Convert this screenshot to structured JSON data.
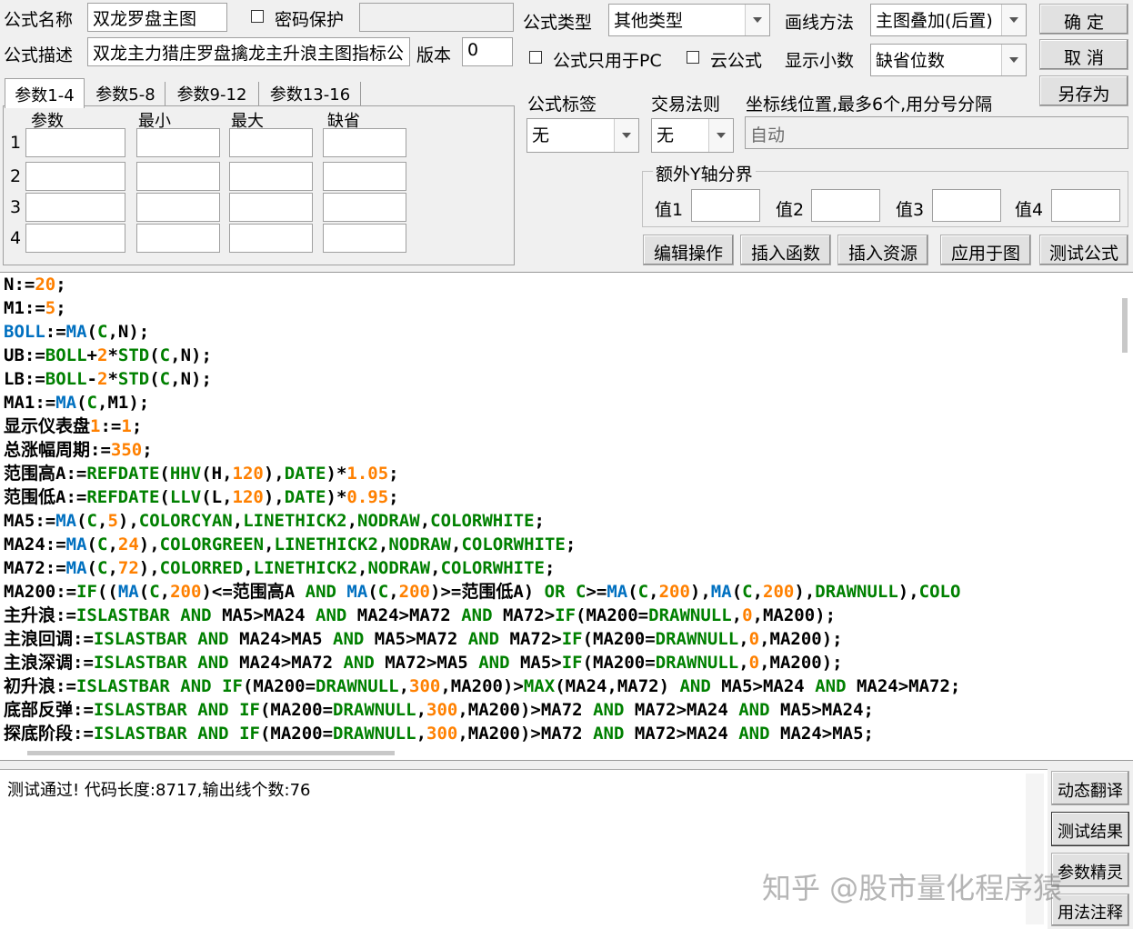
{
  "header": {
    "name_label": "公式名称",
    "name_value": "双龙罗盘主图",
    "password_label": "密码保护",
    "desc_label": "公式描述",
    "desc_value": "双龙主力猎庄罗盘擒龙主升浪主图指标公",
    "version_label": "版本",
    "version_value": "0",
    "type_label": "公式类型",
    "type_value": "其他类型",
    "draw_label": "画线方法",
    "draw_value": "主图叠加(后置)",
    "pc_only_label": "公式只用于PC",
    "cloud_label": "云公式",
    "decimal_label": "显示小数",
    "decimal_value": "缺省位数",
    "tag_label": "公式标签",
    "tag_value": "无",
    "trade_label": "交易法则",
    "trade_value": "无",
    "axis_label": "坐标线位置,最多6个,用分号分隔",
    "axis_value": "自动",
    "extra_y_label": "额外Y轴分界",
    "y1_label": "值1",
    "y2_label": "值2",
    "y3_label": "值3",
    "y4_label": "值4"
  },
  "buttons": {
    "ok": "确 定",
    "cancel": "取 消",
    "save_as": "另存为",
    "edit": "编辑操作",
    "insert_func": "插入函数",
    "insert_res": "插入资源",
    "apply": "应用于图",
    "test": "测试公式"
  },
  "params": {
    "tabs": [
      "参数1-4",
      "参数5-8",
      "参数9-12",
      "参数13-16"
    ],
    "columns": [
      "参数",
      "最小",
      "最大",
      "缺省"
    ],
    "rows": [
      "1",
      "2",
      "3",
      "4"
    ]
  },
  "code_lines": [
    "N:=20;",
    "M1:=5;",
    "BOLL:=MA(C,N);",
    "UB:=BOLL+2*STD(C,N);",
    "LB:=BOLL-2*STD(C,N);",
    "MA1:=MA(C,M1);",
    "显示仪表盘1:=1;",
    "总涨幅周期:=350;",
    "范围高A:=REFDATE(HHV(H,120),DATE)*1.05;",
    "范围低A:=REFDATE(LLV(L,120),DATE)*0.95;",
    "MA5:=MA(C,5),COLORCYAN,LINETHICK2,NODRAW,COLORWHITE;",
    "MA24:=MA(C,24),COLORGREEN,LINETHICK2,NODRAW,COLORWHITE;",
    "MA72:=MA(C,72),COLORRED,LINETHICK2,NODRAW,COLORWHITE;",
    "MA200:=IF((MA(C,200)<=范围高A AND MA(C,200)>=范围低A) OR C>=MA(C,200),MA(C,200),DRAWNULL),COLO",
    "主升浪:=ISLASTBAR AND MA5>MA24 AND MA24>MA72 AND MA72>IF(MA200=DRAWNULL,0,MA200);",
    "主浪回调:=ISLASTBAR AND MA24>MA5 AND MA5>MA72 AND MA72>IF(MA200=DRAWNULL,0,MA200);",
    "主浪深调:=ISLASTBAR AND MA24>MA72 AND MA72>MA5 AND MA5>IF(MA200=DRAWNULL,0,MA200);",
    "初升浪:=ISLASTBAR AND IF(MA200=DRAWNULL,300,MA200)>MAX(MA24,MA72) AND MA5>MA24 AND MA24>MA72;",
    "底部反弹:=ISLASTBAR AND IF(MA200=DRAWNULL,300,MA200)>MA72 AND MA72>MA24 AND MA5>MA24;",
    "探底阶段:=ISLASTBAR AND IF(MA200=DRAWNULL,300,MA200)>MA72 AND MA72>MA24 AND MA24>MA5;"
  ],
  "output": {
    "message": "测试通过! 代码长度:8717,输出线个数:76"
  },
  "side_buttons": [
    "动态翻译",
    "测试结果",
    "参数精灵",
    "用法注释"
  ],
  "watermark": "知乎 @股市量化程序猿",
  "colors": {
    "keyword": "#008000",
    "number": "#ff8000",
    "function": "#0070c0"
  }
}
